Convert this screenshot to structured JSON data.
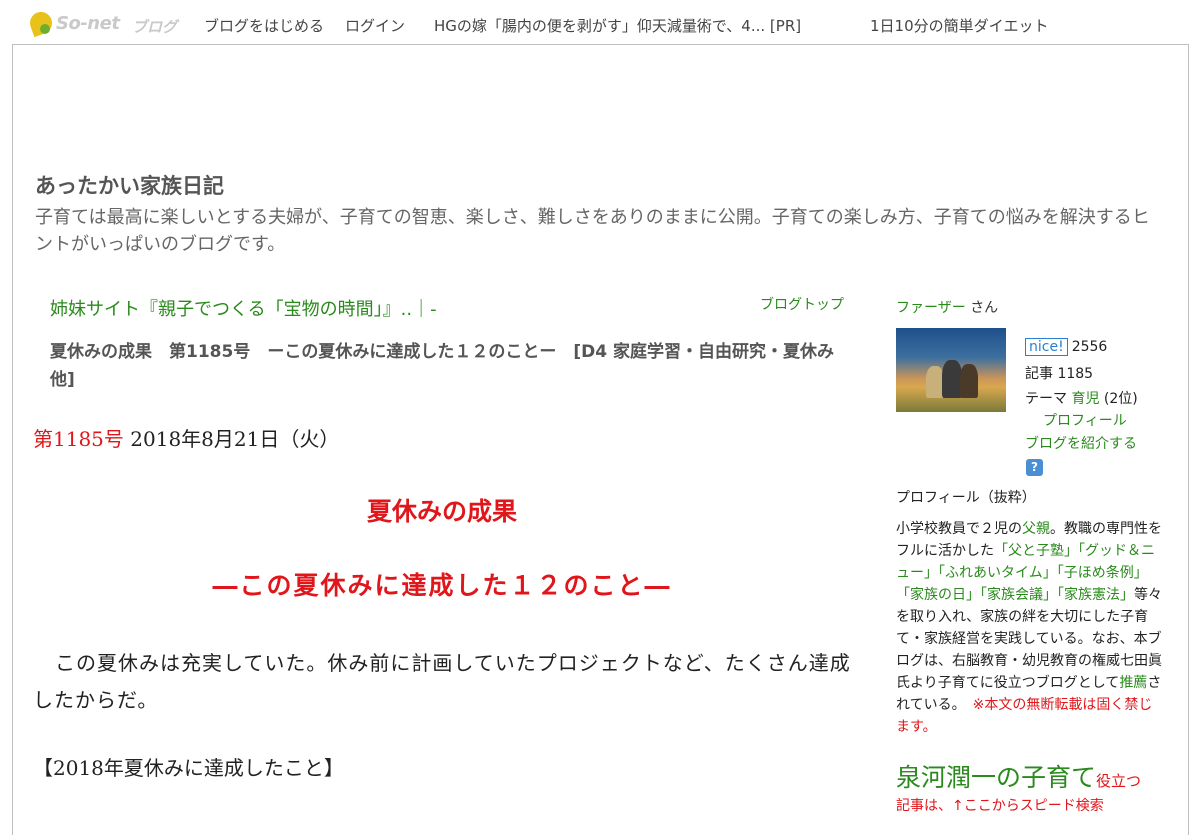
{
  "topbar": {
    "logo_text": "So-net",
    "logo_sub": "ブログ",
    "start_blog": "ブログをはじめる",
    "login": "ログイン",
    "ad": "HGの嫁「腸内の便を剥がす」仰天減量術で、4... [PR]",
    "diet": "1日10分の簡単ダイエット"
  },
  "header": {
    "title": "あったかい家族日記",
    "description": "子育ては最高に楽しいとする夫婦が、子育ての智恵、楽しさ、難しさをありのままに公開。子育ての楽しみ方、子育ての悩みを解決するヒントがいっぱいのブログです。"
  },
  "main": {
    "sister_link": "姉妹サイト『親子でつくる「宝物の時間」』..｜-",
    "blogtop_link": "ブログトップ",
    "entry_title": "夏休みの成果　第1185号　ーこの夏休みに達成した１２のことー　[D4 家庭学習・自由研究・夏休み他]",
    "issue_no": "第1185号",
    "issue_date": "2018年8月21日（火）",
    "heading1": "夏休みの成果",
    "heading2": "―この夏休みに達成した１２のこと―",
    "paragraph": "この夏休みは充実していた。休み前に計画していたプロジェクトなど、たくさん達成したからだ。",
    "section": "【2018年夏休みに達成したこと】"
  },
  "sidebar": {
    "author_name": "ファーザー",
    "author_suffix": "さん",
    "nice_label": "nice!",
    "nice_count": "2556",
    "articles_label": "記事",
    "articles_count": "1185",
    "theme_label": "テーマ",
    "theme_value": "育児",
    "theme_rank": "(2位)",
    "profile_link": "プロフィール",
    "introduce_link": "ブログを紹介する",
    "help_icon": "?",
    "profile_heading": "プロフィール（抜粋）",
    "profile_parts": {
      "p1": "小学校教員で２児の",
      "p2": "父親",
      "p3": "。教職の専門性をフルに活かした",
      "p4": "「父と子塾」「グッド＆ニュー」「ふれあいタイム」「子ほめ条例」「家族の日」「家族会議」「家族憲法」",
      "p5": "等々を取り入れ、家族の絆を大切にした子育て・家族経営を実践している。なお、本ブログは、右脳教育・幼児教育の権威七田眞氏より子育てに役立つブログとして",
      "p6": "推薦",
      "p7": "されている。",
      "p8": "※本文の無断転載は固く禁じます。"
    },
    "big_name": "泉河潤一の子育て",
    "big_name_suffix": "役立つ",
    "search_text": "記事は、↑ここからスピード検索"
  },
  "colors": {
    "accent_green": "#2a8a1c",
    "accent_red": "#e0161b",
    "nice_blue": "#2a7fd4"
  }
}
